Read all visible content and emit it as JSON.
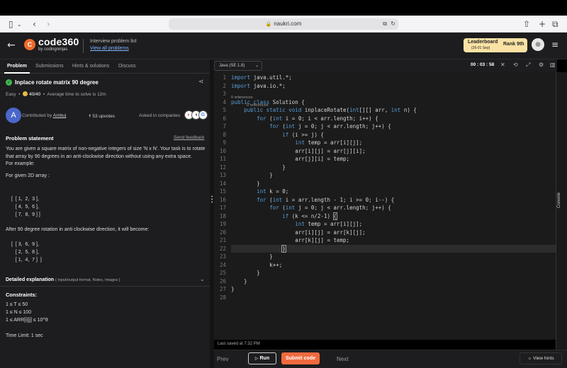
{
  "browser": {
    "url": "naukri.com"
  },
  "header": {
    "brand": "code360",
    "brand_sub": "by codingninjas",
    "crumb_title": "Interview problem list",
    "crumb_link": "View all problems",
    "leaderboard_label": "Leaderboard",
    "leaderboard_date": "(26-01 Sep)",
    "rank_label": "Rank",
    "rank_value": "9th"
  },
  "tabs": [
    "Problem",
    "Submissions",
    "Hints & solutions",
    "Discuss"
  ],
  "problem": {
    "title": "Inplace rotate matrix 90 degree",
    "difficulty": "Easy",
    "score": "40/40",
    "avg_time": "Average time to solve is 12m",
    "avatar_letter": "A",
    "contributed_by": "Contributed by",
    "author": "Ambuj",
    "upvotes": "53 upvotes",
    "asked_in": "Asked in companies",
    "statement_heading": "Problem statement",
    "send_feedback": "Send feedback",
    "statement": "You are given a square matrix of non-negative integers of size 'N x N'. Your task is to rotate that array by 90 degrees in an anti-clockwise direction without using any extra space.",
    "for_example": "For example:",
    "given_label": "For given 2D array :",
    "input_array": [
      "[  [ 1,  2,  3 ],",
      "   [ 4,  5,  6 ],",
      "   [ 7,  8,  9 ] ]"
    ],
    "after_label": "After 90 degree rotation in anti clockwise direction, it will become:",
    "output_array": [
      "[  [ 3,  6,  9 ],",
      "   [ 2,  5,  8 ],",
      "   [ 1,  4,  7 ]  ]"
    ],
    "detail_heading": "Detailed explanation",
    "detail_sub": "( Input/output format, Notes, Images )",
    "constraints_heading": "Constraints:",
    "constraints": [
      "1 ≤ T ≤ 50",
      "1 ≤ N ≤ 100",
      "1 ≤ ARR[i][j] ≤ 10^9"
    ],
    "time_limit": "Time Limit: 1 sec"
  },
  "editor": {
    "language": "Java (SE 1.8)",
    "timer": "00 : 03 : 58",
    "references": "0 references",
    "last_saved": "Last saved at 7:32 PM",
    "line_numbers": [
      "1",
      "2",
      "3",
      "4",
      "5",
      "6",
      "7",
      "8",
      "9",
      "10",
      "11",
      "12",
      "13",
      "14",
      "15",
      "16",
      "17",
      "18",
      "19",
      "20",
      "21",
      "22",
      "23",
      "24",
      "25",
      "26",
      "27",
      "28"
    ]
  },
  "console_label": "Console",
  "footer": {
    "prev": "Prev",
    "run": "Run",
    "submit": "Submit code",
    "next": "Next",
    "hints": "View hints"
  },
  "colors": {
    "accent": "#f06a3e",
    "keyword": "#569cd6",
    "success": "#3fb950"
  }
}
